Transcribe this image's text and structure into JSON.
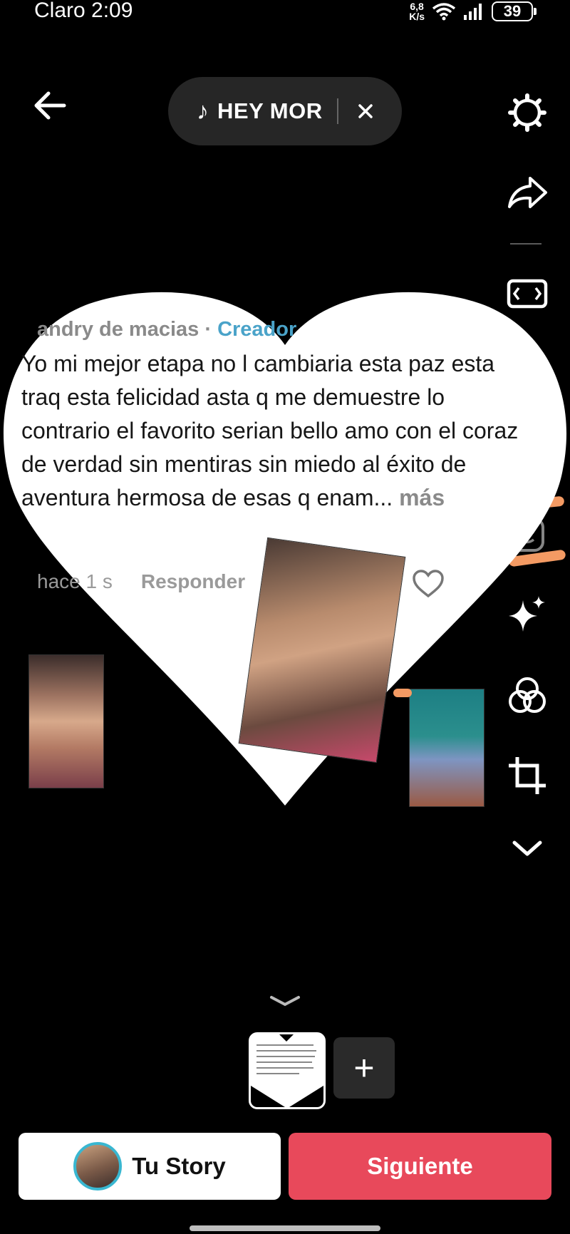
{
  "status": {
    "carrier_time": "Claro 2:09",
    "speed_top": "6,8",
    "speed_unit": "K/s",
    "battery": "39"
  },
  "music": {
    "title": "HEY MOR"
  },
  "comment": {
    "author": "andry de macias · ",
    "role": "Creador",
    "text": "Yo mi mejor etapa no l cambiaria esta paz esta traq esta felicidad asta q me demuestre lo contrario el favorito serian bello amo con el coraz de verdad sin mentiras sin miedo al éxito de aventura hermosa de esas q enam... ",
    "more": "más",
    "time": "hace 1 s",
    "reply": "Responder"
  },
  "tools": [
    "settings-icon",
    "share-icon",
    "aspect-icon",
    "sticker-icon",
    "text-icon",
    "emoji-icon",
    "effects-icon",
    "filters-icon",
    "crop-icon",
    "more-icon"
  ],
  "bottom": {
    "add": "+",
    "story_label": "Tu Story",
    "next_label": "Siguiente"
  },
  "colors": {
    "accent": "#e8495b",
    "story_ring": "#39b7d1",
    "creator": "#4aa3c9"
  }
}
